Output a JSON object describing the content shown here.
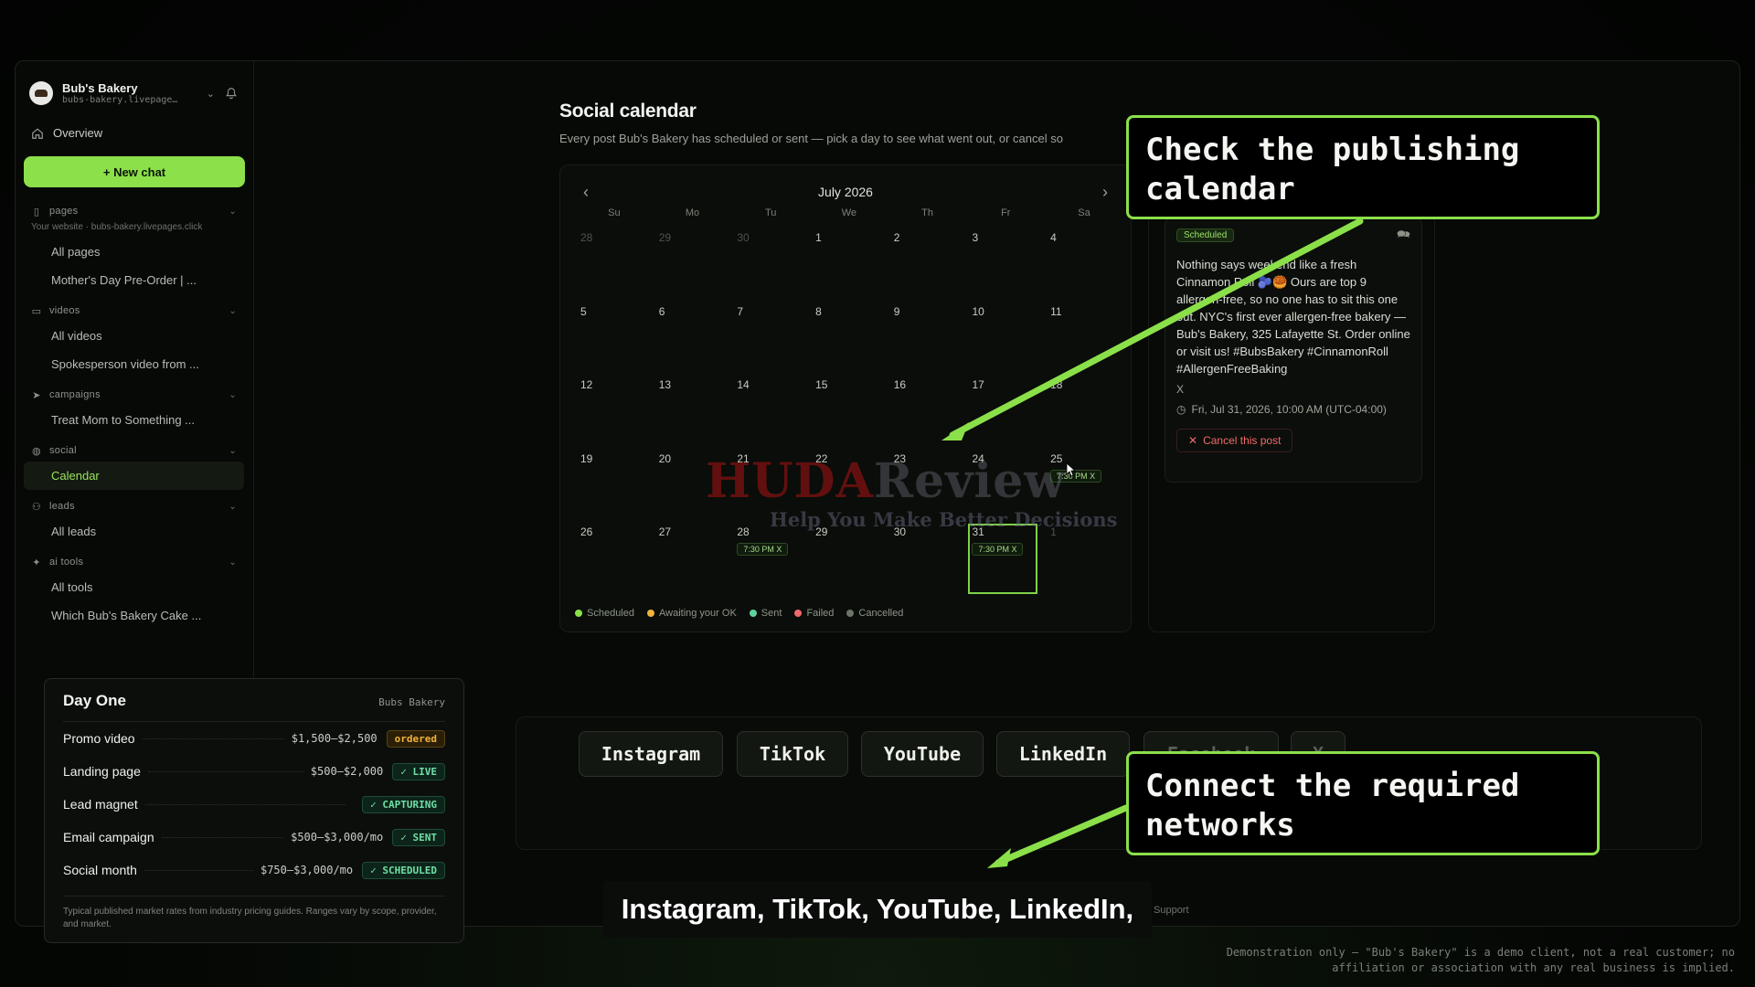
{
  "sidebar": {
    "brand_name": "Bub's Bakery",
    "brand_url": "bubs-bakery.livepage…",
    "overview": "Overview",
    "new_chat": "+ New chat",
    "sections": [
      {
        "label": "pages",
        "note": "Your website · bubs-bakery.livepages.click",
        "items": [
          "All pages",
          "Mother's Day Pre-Order | ..."
        ]
      },
      {
        "label": "videos",
        "items": [
          "All videos",
          "Spokesperson video from ..."
        ]
      },
      {
        "label": "campaigns",
        "items": [
          "Treat Mom to Something ..."
        ]
      },
      {
        "label": "social",
        "items": [
          "Calendar"
        ]
      },
      {
        "label": "leads",
        "items": [
          "All leads"
        ]
      },
      {
        "label": "ai tools",
        "items": [
          "All tools",
          "Which Bub's Bakery Cake ..."
        ]
      }
    ]
  },
  "calendar": {
    "title": "Social calendar",
    "subtitle": "Every post Bub's Bakery has scheduled or sent — pick a day to see what went out, or cancel so",
    "month": "July 2026",
    "weekdays": [
      "Su",
      "Mo",
      "Tu",
      "We",
      "Th",
      "Fr",
      "Sa"
    ],
    "days": [
      {
        "d": "28",
        "m": true
      },
      {
        "d": "29",
        "m": true
      },
      {
        "d": "30",
        "m": true
      },
      {
        "d": "1"
      },
      {
        "d": "2"
      },
      {
        "d": "3"
      },
      {
        "d": "4"
      },
      {
        "d": "5"
      },
      {
        "d": "6"
      },
      {
        "d": "7"
      },
      {
        "d": "8"
      },
      {
        "d": "9"
      },
      {
        "d": "10"
      },
      {
        "d": "11"
      },
      {
        "d": "12"
      },
      {
        "d": "13"
      },
      {
        "d": "14"
      },
      {
        "d": "15"
      },
      {
        "d": "16"
      },
      {
        "d": "17"
      },
      {
        "d": "18"
      },
      {
        "d": "19"
      },
      {
        "d": "20"
      },
      {
        "d": "21"
      },
      {
        "d": "22"
      },
      {
        "d": "23"
      },
      {
        "d": "24"
      },
      {
        "d": "25",
        "chip": "7:30 PM X"
      },
      {
        "d": "26"
      },
      {
        "d": "27"
      },
      {
        "d": "28",
        "chip": "7:30 PM X"
      },
      {
        "d": "29"
      },
      {
        "d": "30"
      },
      {
        "d": "31",
        "chip": "7:30 PM X",
        "sel": true
      },
      {
        "d": "1",
        "m": true
      }
    ],
    "legend": [
      {
        "label": "Scheduled",
        "color": "#8ce04a"
      },
      {
        "label": "Awaiting your OK",
        "color": "#f0b23a"
      },
      {
        "label": "Sent",
        "color": "#5fd19a"
      },
      {
        "label": "Failed",
        "color": "#f06a6a"
      },
      {
        "label": "Cancelled",
        "color": "#6c7369"
      }
    ]
  },
  "post": {
    "status": "Scheduled",
    "body": "Nothing says weekend like a fresh Cinnamon Roll 🫐🥮 Ours are top 9 allergen-free, so no one has to sit this one out. NYC's first ever allergen-free bakery — Bub's Bakery, 325 Lafayette St. Order online or visit us! #BubsBakery #CinnamonRoll #AllergenFreeBaking",
    "network": "X",
    "time": "Fri, Jul 31, 2026, 10:00 AM (UTC-04:00)",
    "cancel": "Cancel this post"
  },
  "networks": [
    "Instagram",
    "TikTok",
    "YouTube",
    "LinkedIn",
    "Facebook",
    "X"
  ],
  "callouts": {
    "calendar": "Check the publishing calendar",
    "networks": "Connect the required networks"
  },
  "caption": "Instagram, TikTok, YouTube, LinkedIn,",
  "support": "Support",
  "day_one": {
    "title": "Day One",
    "client": "Bubs Bakery",
    "rows": [
      {
        "name": "Promo video",
        "price": "$1,500–$2,500",
        "status": "ordered",
        "kind": "ordered"
      },
      {
        "name": "Landing page",
        "price": "$500–$2,000",
        "status": "✓ LIVE",
        "kind": "green"
      },
      {
        "name": "Lead magnet",
        "price": "",
        "status": "✓ CAPTURING",
        "kind": "green"
      },
      {
        "name": "Email campaign",
        "price": "$500–$3,000/mo",
        "status": "✓ SENT",
        "kind": "green"
      },
      {
        "name": "Social month",
        "price": "$750–$3,000/mo",
        "status": "✓ SCHEDULED",
        "kind": "green"
      }
    ],
    "footnote": "Typical published market rates from industry pricing guides. Ranges vary by scope, provider, and market."
  },
  "disclaimer": "Demonstration only — \"Bub's Bakery\" is a demo client, not a real customer; no affiliation or association with any real business is implied.",
  "watermark": {
    "main_red": "HUDA",
    "main_grey": "Review",
    "sub": "Help You Make Better Decisions"
  },
  "colors": {
    "accent": "#8ce04a",
    "background": "#050705"
  }
}
